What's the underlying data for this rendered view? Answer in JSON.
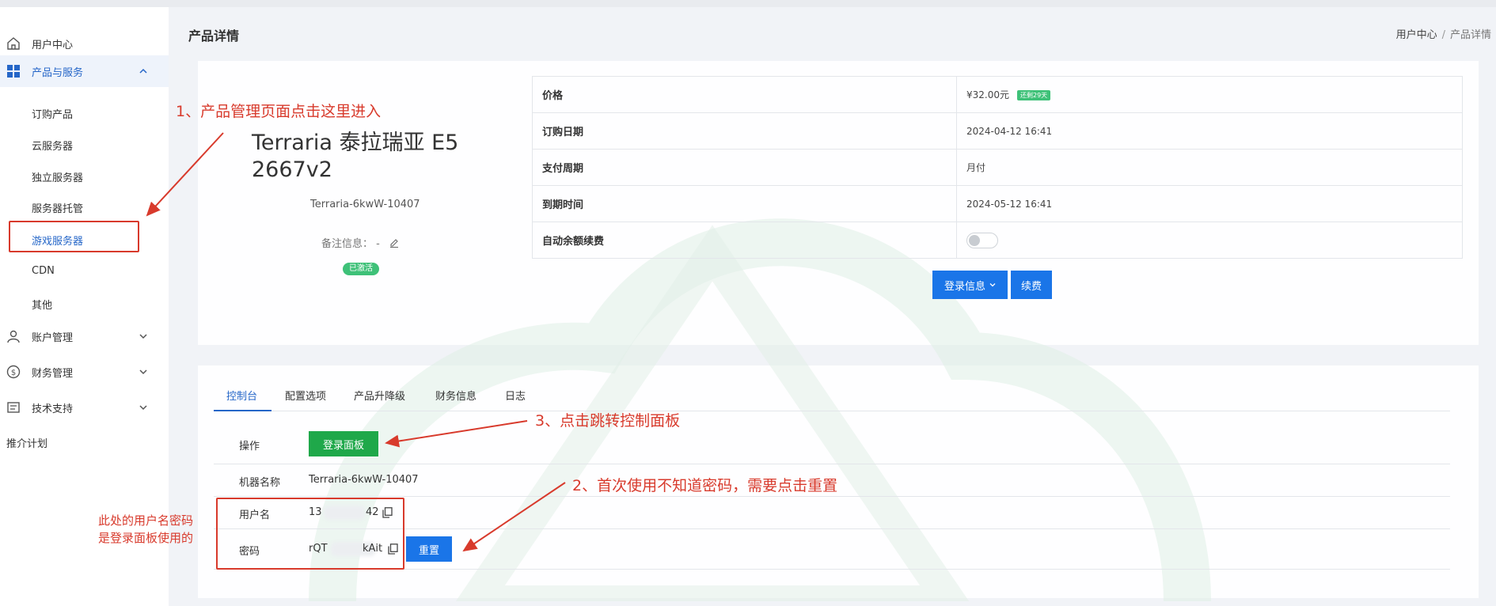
{
  "header": {
    "page_title": "产品详情",
    "breadcrumb": [
      "用户中心",
      "/",
      "产品详情"
    ]
  },
  "sidebar": {
    "items": [
      {
        "label": "用户中心",
        "icon": "home-icon"
      },
      {
        "label": "产品与服务",
        "icon": "grid-icon",
        "expanded": true
      },
      {
        "label": "账户管理",
        "icon": "user-icon"
      },
      {
        "label": "财务管理",
        "icon": "dollar-icon"
      },
      {
        "label": "技术支持",
        "icon": "ticket-icon"
      },
      {
        "label": "推介计划"
      }
    ],
    "sub_items": [
      "订购产品",
      "云服务器",
      "独立服务器",
      "服务器托管",
      "游戏服务器",
      "CDN",
      "其他"
    ],
    "selected_sub": "游戏服务器"
  },
  "product": {
    "name": "Terraria 泰拉瑞亚 E5 2667v2",
    "id": "Terraria-6kwW-10407",
    "note_label": "备注信息：",
    "note_value": "-",
    "status": "已激活"
  },
  "info": {
    "rows": [
      {
        "key": "价格",
        "value": "¥32.00元",
        "badge": "还剩29天"
      },
      {
        "key": "订购日期",
        "value": "2024-04-12 16:41"
      },
      {
        "key": "支付周期",
        "value": "月付"
      },
      {
        "key": "到期时间",
        "value": "2024-05-12 16:41"
      },
      {
        "key": "自动余额续费",
        "toggle": false
      }
    ],
    "login_info_button": "登录信息",
    "renew_button": "续费"
  },
  "tabs": [
    "控制台",
    "配置选项",
    "产品升降级",
    "财务信息",
    "日志"
  ],
  "active_tab": "控制台",
  "console": {
    "operation_label": "操作",
    "login_panel_button": "登录面板",
    "machine_label": "机器名称",
    "machine_value": "Terraria-6kwW-10407",
    "username_label": "用户名",
    "username_prefix": "13",
    "username_suffix": "42",
    "password_label": "密码",
    "password_prefix": "rQT",
    "password_suffix": "kAit",
    "reset_button": "重置"
  },
  "annotations": {
    "step1": "1、产品管理页面点击这里进入",
    "step2": "2、首次使用不知道密码，需要点击重置",
    "step3": "3、点击跳转控制面板",
    "side_note_line1": "此处的用户名密码",
    "side_note_line2": "是登录面板使用的",
    "color": "#d83a2c"
  },
  "colors": {
    "primary": "#1a75e8",
    "success": "#1fa84a",
    "badge_green": "#3ec178"
  }
}
